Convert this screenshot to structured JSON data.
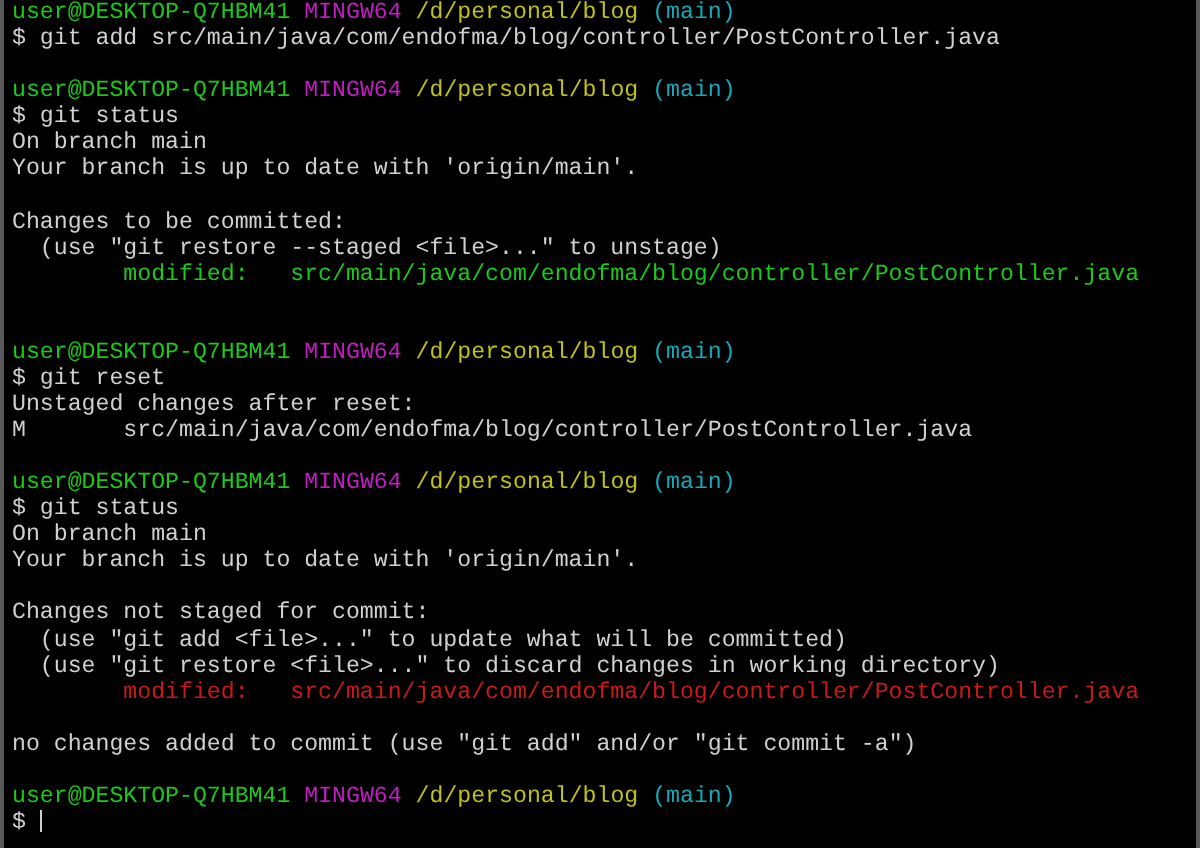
{
  "terminal": {
    "lines": [
      {
        "kind": "text",
        "segments": [
          {
            "kind": "user",
            "text": "user@DESKTOP-Q7HBM41"
          },
          {
            "kind": "shell",
            "text": "MINGW64"
          },
          {
            "kind": "path",
            "text": "/d/personal/blog"
          },
          {
            "kind": "branch",
            "text": "(main)"
          }
        ]
      },
      {
        "kind": "text",
        "segments": [
          {
            "kind": "command",
            "text": "$ git add src/main/java/com/endofma/blog/controller/PostController.java"
          }
        ]
      },
      {
        "kind": "blank"
      },
      {
        "kind": "text",
        "segments": [
          {
            "kind": "user",
            "text": "user@DESKTOP-Q7HBM41"
          },
          {
            "kind": "shell",
            "text": "MINGW64"
          },
          {
            "kind": "path",
            "text": "/d/personal/blog"
          },
          {
            "kind": "branch",
            "text": "(main)"
          }
        ]
      },
      {
        "kind": "text",
        "segments": [
          {
            "kind": "command",
            "text": "$ git status"
          }
        ]
      },
      {
        "kind": "text",
        "segments": [
          {
            "kind": "output",
            "text": "On branch main"
          }
        ]
      },
      {
        "kind": "text",
        "segments": [
          {
            "kind": "output",
            "text": "Your branch is up to date with 'origin/main'."
          }
        ]
      },
      {
        "kind": "blank"
      },
      {
        "kind": "text",
        "segments": [
          {
            "kind": "output",
            "text": "Changes to be committed:"
          }
        ]
      },
      {
        "kind": "text",
        "segments": [
          {
            "kind": "output",
            "text": "  (use \"git restore --staged <file>...\" to unstage)"
          }
        ]
      },
      {
        "kind": "tab_entry",
        "segments": [
          {
            "kind": "staged",
            "text": "modified:"
          },
          {
            "kind": "staged",
            "text": "src/main/java/com/endofma/blog/controller/PostController.java"
          }
        ]
      },
      {
        "kind": "blank"
      },
      {
        "kind": "blank"
      },
      {
        "kind": "text",
        "segments": [
          {
            "kind": "user",
            "text": "user@DESKTOP-Q7HBM41"
          },
          {
            "kind": "shell",
            "text": "MINGW64"
          },
          {
            "kind": "path",
            "text": "/d/personal/blog"
          },
          {
            "kind": "branch",
            "text": "(main)"
          }
        ]
      },
      {
        "kind": "text",
        "segments": [
          {
            "kind": "command",
            "text": "$ git reset"
          }
        ]
      },
      {
        "kind": "text",
        "segments": [
          {
            "kind": "output",
            "text": "Unstaged changes after reset:"
          }
        ]
      },
      {
        "kind": "code_entry",
        "segments": [
          {
            "kind": "output",
            "text": "M"
          },
          {
            "kind": "output",
            "text": "src/main/java/com/endofma/blog/controller/PostController.java"
          }
        ]
      },
      {
        "kind": "blank"
      },
      {
        "kind": "text",
        "segments": [
          {
            "kind": "user",
            "text": "user@DESKTOP-Q7HBM41"
          },
          {
            "kind": "shell",
            "text": "MINGW64"
          },
          {
            "kind": "path",
            "text": "/d/personal/blog"
          },
          {
            "kind": "branch",
            "text": "(main)"
          }
        ]
      },
      {
        "kind": "text",
        "segments": [
          {
            "kind": "command",
            "text": "$ git status"
          }
        ]
      },
      {
        "kind": "text",
        "segments": [
          {
            "kind": "output",
            "text": "On branch main"
          }
        ]
      },
      {
        "kind": "text",
        "segments": [
          {
            "kind": "output",
            "text": "Your branch is up to date with 'origin/main'."
          }
        ]
      },
      {
        "kind": "blank"
      },
      {
        "kind": "text",
        "segments": [
          {
            "kind": "output",
            "text": "Changes not staged for commit:"
          }
        ]
      },
      {
        "kind": "text",
        "segments": [
          {
            "kind": "output",
            "text": "  (use \"git add <file>...\" to update what will be committed)"
          }
        ]
      },
      {
        "kind": "text",
        "segments": [
          {
            "kind": "output",
            "text": "  (use \"git restore <file>...\" to discard changes in working directory)"
          }
        ]
      },
      {
        "kind": "tab_entry",
        "segments": [
          {
            "kind": "unstaged",
            "text": "modified:"
          },
          {
            "kind": "unstaged",
            "text": "src/main/java/com/endofma/blog/controller/PostController.java"
          }
        ]
      },
      {
        "kind": "blank"
      },
      {
        "kind": "text",
        "segments": [
          {
            "kind": "output",
            "text": "no changes added to commit (use \"git add\" and/or \"git commit -a\")"
          }
        ]
      },
      {
        "kind": "blank"
      },
      {
        "kind": "text",
        "segments": [
          {
            "kind": "user",
            "text": "user@DESKTOP-Q7HBM41"
          },
          {
            "kind": "shell",
            "text": "MINGW64"
          },
          {
            "kind": "path",
            "text": "/d/personal/blog"
          },
          {
            "kind": "branch",
            "text": "(main)"
          }
        ]
      },
      {
        "kind": "prompt",
        "segments": [
          {
            "kind": "command",
            "text": "$"
          }
        ]
      }
    ]
  }
}
